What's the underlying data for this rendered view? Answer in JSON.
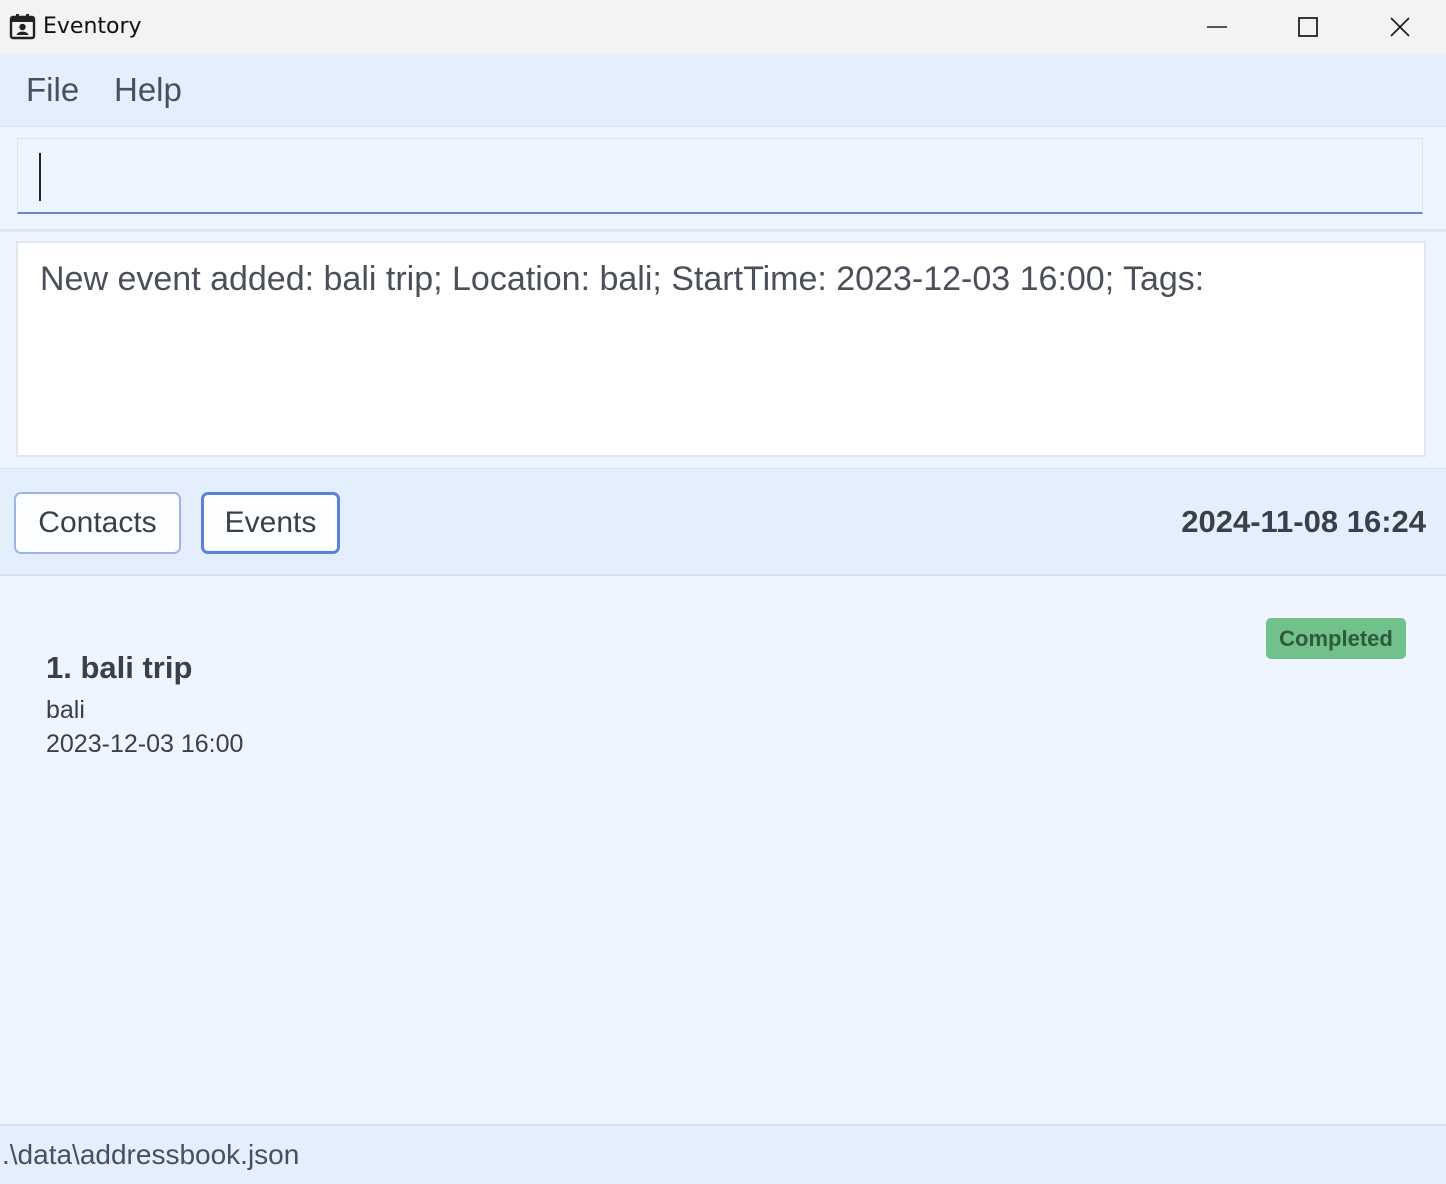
{
  "window": {
    "title": "Eventory",
    "icon": "calendar-contact-icon"
  },
  "menu": {
    "items": [
      {
        "label": "File"
      },
      {
        "label": "Help"
      }
    ]
  },
  "command": {
    "value": "",
    "placeholder": ""
  },
  "result": {
    "message": "New event added: bali trip; Location: bali; StartTime: 2023-12-03 16:00; Tags:"
  },
  "tabs": [
    {
      "label": "Contacts",
      "selected": false
    },
    {
      "label": "Events",
      "selected": true
    }
  ],
  "clock": "2024-11-08 16:24",
  "events": [
    {
      "title": "1. bali trip",
      "location": "bali",
      "start_time": "2023-12-03 16:00",
      "status": "Completed",
      "status_color": "#72c08c"
    }
  ],
  "status_bar": {
    "path": ".\\data\\addressbook.json"
  },
  "colors": {
    "accent": "#5b82d8",
    "background": "#eef5fe",
    "panel": "#e3effd"
  }
}
